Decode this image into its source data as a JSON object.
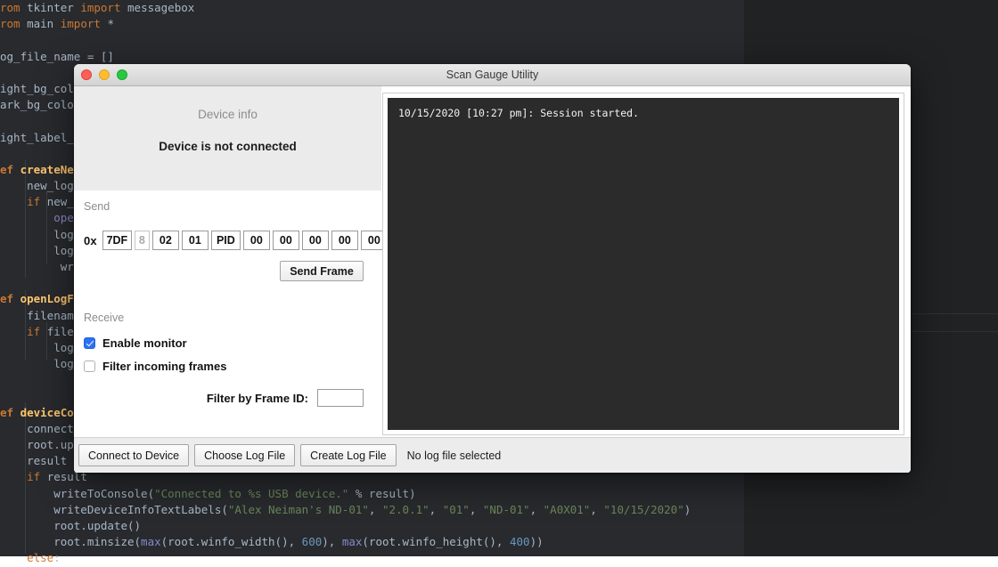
{
  "background_editor": {
    "language": "python",
    "code_lines": [
      {
        "segments": [
          {
            "t": "rom ",
            "c": "tk-kw"
          },
          {
            "t": "tkinter ",
            "c": "tk-pl"
          },
          {
            "t": "import ",
            "c": "tk-kw"
          },
          {
            "t": "messagebox",
            "c": "tk-pl"
          }
        ]
      },
      {
        "segments": [
          {
            "t": "rom ",
            "c": "tk-kw"
          },
          {
            "t": "main ",
            "c": "tk-pl"
          },
          {
            "t": "import ",
            "c": "tk-kw"
          },
          {
            "t": "*",
            "c": "tk-pl"
          }
        ]
      },
      {
        "segments": []
      },
      {
        "segments": [
          {
            "t": "og_file_name = []",
            "c": "tk-pl"
          }
        ]
      },
      {
        "segments": []
      },
      {
        "segments": [
          {
            "t": "ight_bg_colo",
            "c": "tk-pl"
          }
        ]
      },
      {
        "segments": [
          {
            "t": "ark_bg_color",
            "c": "tk-pl"
          }
        ]
      },
      {
        "segments": []
      },
      {
        "segments": [
          {
            "t": "ight_label_c",
            "c": "tk-pl"
          }
        ]
      },
      {
        "segments": []
      },
      {
        "segments": [
          {
            "t": "ef ",
            "c": "tk-def"
          },
          {
            "t": "createNew",
            "c": "tk-nm"
          }
        ]
      },
      {
        "segments": [
          {
            "t": "    new_log_f",
            "c": "tk-pl"
          }
        ]
      },
      {
        "segments": [
          {
            "t": "    ",
            "c": "tk-pl"
          },
          {
            "t": "if ",
            "c": "tk-kw"
          },
          {
            "t": "new_lo",
            "c": "tk-pl"
          }
        ]
      },
      {
        "segments": [
          {
            "t": "        ",
            "c": "tk-pl"
          },
          {
            "t": "open(",
            "c": "tk-bi"
          }
        ]
      },
      {
        "segments": [
          {
            "t": "        logFi",
            "c": "tk-pl"
          }
        ]
      },
      {
        "segments": [
          {
            "t": "        log_f",
            "c": "tk-pl"
          }
        ]
      },
      {
        "segments": [
          {
            "t": "         write",
            "c": "tk-pl"
          }
        ]
      },
      {
        "segments": []
      },
      {
        "segments": [
          {
            "t": "ef ",
            "c": "tk-def"
          },
          {
            "t": "openLogFi",
            "c": "tk-nm"
          }
        ]
      },
      {
        "segments": [
          {
            "t": "    filename",
            "c": "tk-pl"
          }
        ]
      },
      {
        "segments": [
          {
            "t": "    ",
            "c": "tk-pl"
          },
          {
            "t": "if ",
            "c": "tk-kw"
          },
          {
            "t": "filena",
            "c": "tk-pl"
          }
        ]
      },
      {
        "segments": [
          {
            "t": "        logFi",
            "c": "tk-pl"
          }
        ]
      },
      {
        "segments": [
          {
            "t": "        log_f",
            "c": "tk-pl"
          }
        ]
      },
      {
        "segments": []
      },
      {
        "segments": []
      },
      {
        "segments": [
          {
            "t": "ef ",
            "c": "tk-def"
          },
          {
            "t": "deviceCon",
            "c": "tk-nm"
          }
        ]
      },
      {
        "segments": [
          {
            "t": "    connectBu",
            "c": "tk-pl"
          }
        ]
      },
      {
        "segments": [
          {
            "t": "    root.upda",
            "c": "tk-pl"
          }
        ]
      },
      {
        "segments": [
          {
            "t": "    result = ",
            "c": "tk-pl"
          }
        ]
      },
      {
        "segments": [
          {
            "t": "    ",
            "c": "tk-pl"
          },
          {
            "t": "if ",
            "c": "tk-kw"
          },
          {
            "t": "result",
            "c": "tk-pl"
          }
        ]
      },
      {
        "segments": [
          {
            "t": "        writeToConsole(",
            "c": "tk-pl"
          },
          {
            "t": "\"Connected to %s USB device.\"",
            "c": "tk-str"
          },
          {
            "t": " % result)",
            "c": "tk-pl"
          }
        ]
      },
      {
        "segments": [
          {
            "t": "        writeDeviceInfoTextLabels(",
            "c": "tk-pl"
          },
          {
            "t": "\"Alex Neiman's ND-01\"",
            "c": "tk-str"
          },
          {
            "t": ", ",
            "c": "tk-pl"
          },
          {
            "t": "\"2.0.1\"",
            "c": "tk-str"
          },
          {
            "t": ", ",
            "c": "tk-pl"
          },
          {
            "t": "\"01\"",
            "c": "tk-str"
          },
          {
            "t": ", ",
            "c": "tk-pl"
          },
          {
            "t": "\"ND-01\"",
            "c": "tk-str"
          },
          {
            "t": ", ",
            "c": "tk-pl"
          },
          {
            "t": "\"A0X01\"",
            "c": "tk-str"
          },
          {
            "t": ", ",
            "c": "tk-pl"
          },
          {
            "t": "\"10/15/2020\"",
            "c": "tk-str"
          },
          {
            "t": ")",
            "c": "tk-pl"
          }
        ]
      },
      {
        "segments": [
          {
            "t": "        root.update()",
            "c": "tk-pl"
          }
        ]
      },
      {
        "segments": [
          {
            "t": "        root.minsize(",
            "c": "tk-pl"
          },
          {
            "t": "max",
            "c": "tk-bi"
          },
          {
            "t": "(root.winfo_width(), ",
            "c": "tk-pl"
          },
          {
            "t": "600",
            "c": "tk-num"
          },
          {
            "t": "), ",
            "c": "tk-pl"
          },
          {
            "t": "max",
            "c": "tk-bi"
          },
          {
            "t": "(root.winfo_height(), ",
            "c": "tk-pl"
          },
          {
            "t": "400",
            "c": "tk-num"
          },
          {
            "t": "))",
            "c": "tk-pl"
          }
        ]
      },
      {
        "segments": [
          {
            "t": "    ",
            "c": "tk-pl"
          },
          {
            "t": "else",
            "c": "tk-kw"
          },
          {
            "t": ":",
            "c": "tk-pl"
          }
        ]
      }
    ]
  },
  "window": {
    "title": "Scan Gauge Utility",
    "traffic_lights": [
      "close-button",
      "minimize-button",
      "zoom-button"
    ]
  },
  "device_info": {
    "title": "Device info",
    "status": "Device is not connected"
  },
  "send": {
    "label": "Send",
    "hex_prefix": "0x",
    "frame_fields": [
      {
        "value": "7DF",
        "dim": false,
        "wide": true
      },
      {
        "value": "8",
        "dim": true,
        "wide": false
      },
      {
        "value": "02",
        "dim": false,
        "wide": false
      },
      {
        "value": "01",
        "dim": false,
        "wide": false
      },
      {
        "value": "PID",
        "dim": false,
        "wide": true
      },
      {
        "value": "00",
        "dim": false,
        "wide": false
      },
      {
        "value": "00",
        "dim": false,
        "wide": false
      },
      {
        "value": "00",
        "dim": false,
        "wide": false
      },
      {
        "value": "00",
        "dim": false,
        "wide": false
      },
      {
        "value": "00",
        "dim": false,
        "wide": false
      }
    ],
    "send_button": "Send Frame"
  },
  "receive": {
    "label": "Receive",
    "enable_monitor_label": "Enable monitor",
    "enable_monitor_checked": true,
    "filter_frames_label": "Filter incoming frames",
    "filter_frames_checked": false,
    "filter_id_label": "Filter by Frame ID:",
    "filter_id_value": "",
    "filter_id_placeholder": ""
  },
  "console": {
    "text": "10/15/2020 [10:27 pm]: Session started."
  },
  "bottom_bar": {
    "connect_button": "Connect to Device",
    "choose_log_button": "Choose Log File",
    "create_log_button": "Create Log File",
    "log_status": "No log file selected"
  },
  "colors": {
    "accent_checkbox": "#2b71f2",
    "console_bg": "#2b2b2b",
    "window_chrome": "#ececec",
    "device_info_bg": "#ebebeb",
    "editor_bg": "#282a2e"
  }
}
